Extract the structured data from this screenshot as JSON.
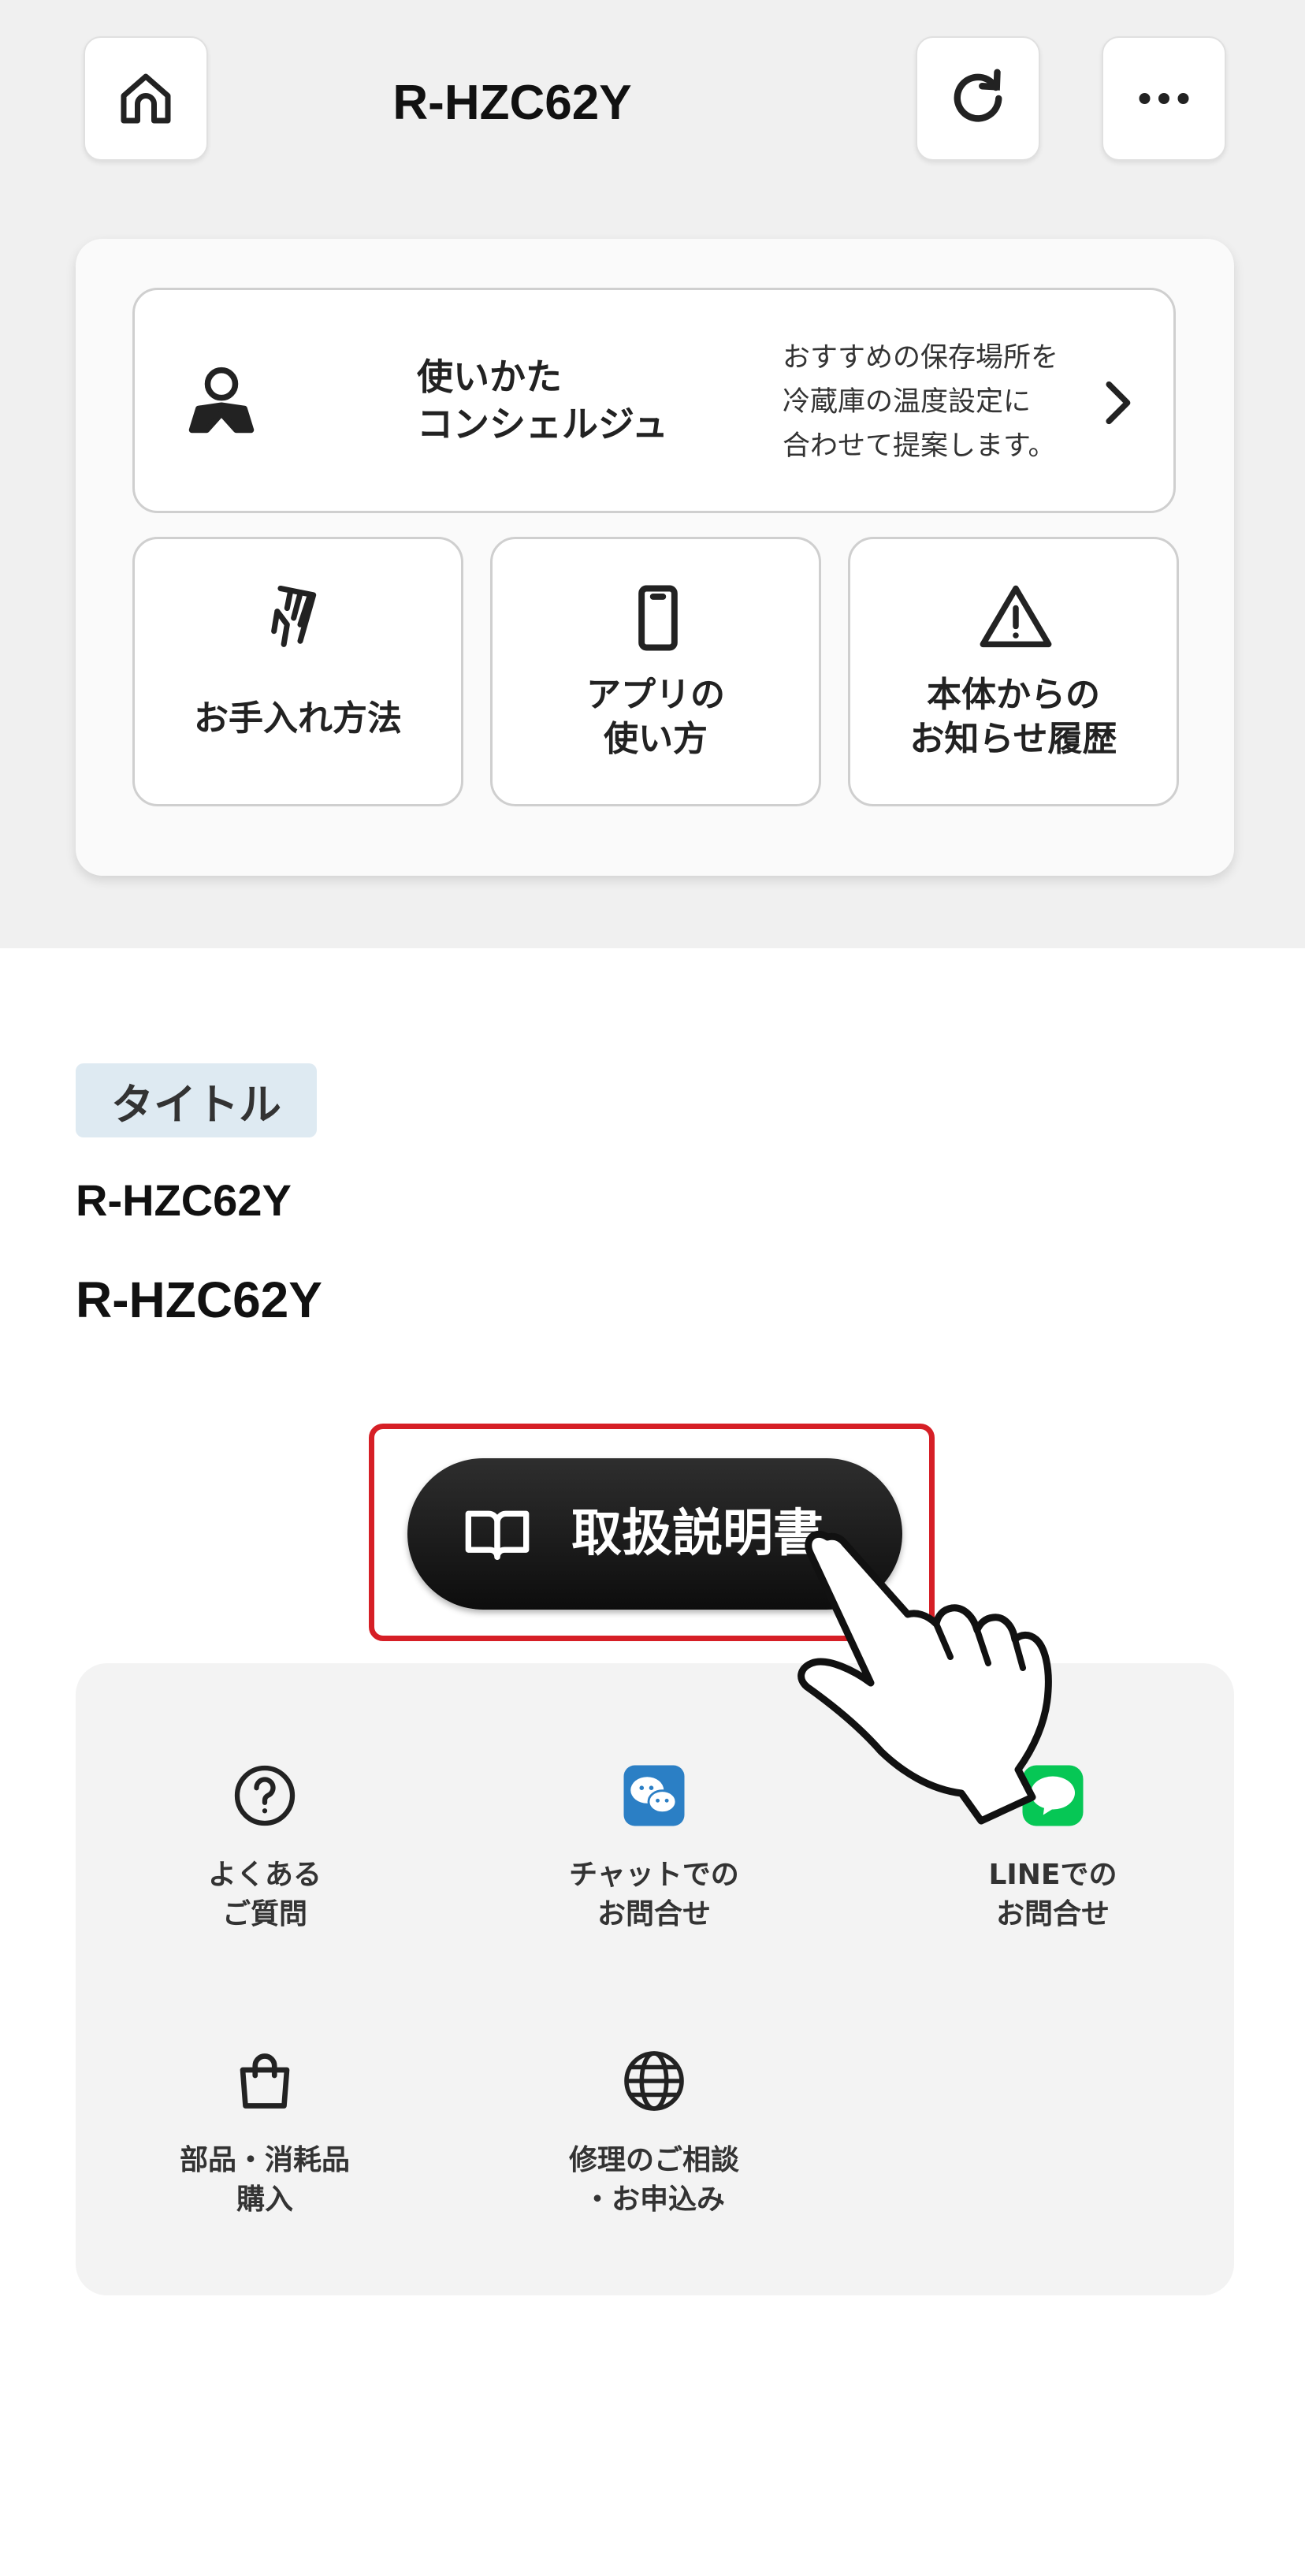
{
  "header": {
    "title": "R-HZC62Y",
    "home_icon": "home-icon",
    "refresh_icon": "refresh-icon",
    "more_icon": "more-icon"
  },
  "concierge": {
    "title": "使いかた\nコンシェルジュ",
    "description": "おすすめの保存場所を\n冷蔵庫の温度設定に\n合わせて提案します。",
    "icon": "person-icon"
  },
  "tiles": [
    {
      "label": "お手入れ方法",
      "icon": "cleaning-icon"
    },
    {
      "label": "アプリの\n使い方",
      "icon": "smartphone-icon"
    },
    {
      "label": "本体からの\nお知らせ履歴",
      "icon": "warning-icon"
    }
  ],
  "info": {
    "tag": "タイトル",
    "model_small": "R-HZC62Y",
    "model_large": "R-HZC62Y"
  },
  "manual_button": {
    "label": "取扱説明書",
    "icon": "book-icon"
  },
  "support": [
    {
      "label": "よくある\nご質問",
      "icon": "question-icon"
    },
    {
      "label": "チャットでの\nお問合せ",
      "icon": "chat-icon"
    },
    {
      "label": "LINEでの\nお問合せ",
      "icon": "line-icon"
    },
    {
      "label": "部品・消耗品\n購入",
      "icon": "shopping-bag-icon"
    },
    {
      "label": "修理のご相談\n・お申込み",
      "icon": "globe-icon"
    }
  ],
  "colors": {
    "highlight": "#d61f26",
    "tag_bg": "#deeaf2",
    "chat_blue": "#2b7fc5",
    "line_green": "#06c755"
  }
}
